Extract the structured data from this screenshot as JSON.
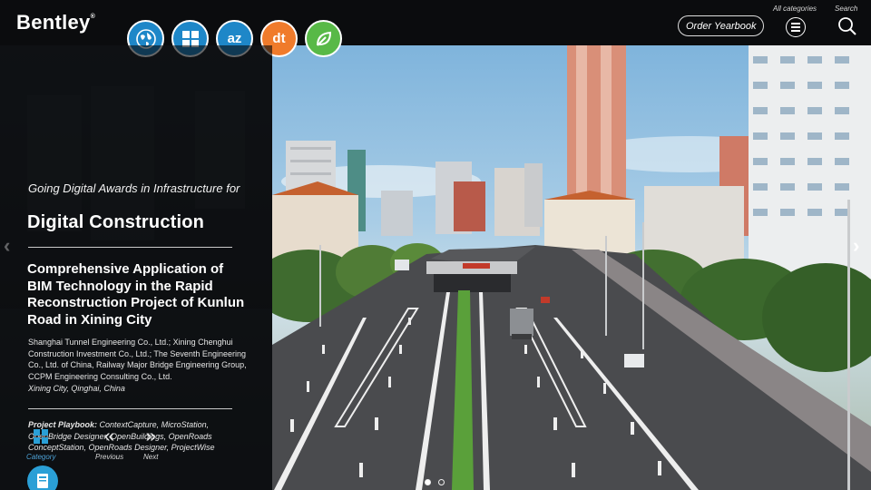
{
  "brand": {
    "logo_text": "Bentley",
    "logo_mark": "®"
  },
  "categories": [
    {
      "icon": "globe-icon",
      "glyph": ""
    },
    {
      "icon": "grid-icon",
      "glyph": ""
    },
    {
      "icon": "az-icon",
      "glyph": "az"
    },
    {
      "icon": "digital-twin-icon",
      "glyph": "dt"
    },
    {
      "icon": "leaf-icon",
      "glyph": ""
    }
  ],
  "header": {
    "order_label": "Order Yearbook",
    "all_categories_label": "All categories",
    "search_label": "Search"
  },
  "award": {
    "line": "Going Digital Awards in Infrastructure for",
    "title": "Digital Construction"
  },
  "project": {
    "title": "Comprehensive Application of BIM Technology in the Rapid Reconstruction Project of Kunlun Road in Xining City",
    "organizations": "Shanghai Tunnel Engineering Co., Ltd.; Xining Chenghui Construction Investment Co., Ltd.; The Seventh Engineering Co., Ltd. of China, Railway Major Bridge Engineering Group, CCPM Engineering Consulting Co., Ltd.",
    "location": "Xining City, Qinghai, China",
    "playbook_label": "Project Playbook:",
    "playbook_products": "ContextCapture, MicroStation, OpenBridge Designer, OpenBuildings, OpenRoads ConceptStation, OpenRoads Designer, ProjectWise"
  },
  "nav": {
    "category_label": "Category",
    "previous_label": "Previous",
    "next_label": "Next"
  },
  "carousel": {
    "slides": 2,
    "active": 1
  },
  "colors": {
    "accent_blue": "#1e87c8",
    "accent_orange": "#f07b2b",
    "accent_green": "#58b947",
    "topbar": "#0b0c0e"
  }
}
